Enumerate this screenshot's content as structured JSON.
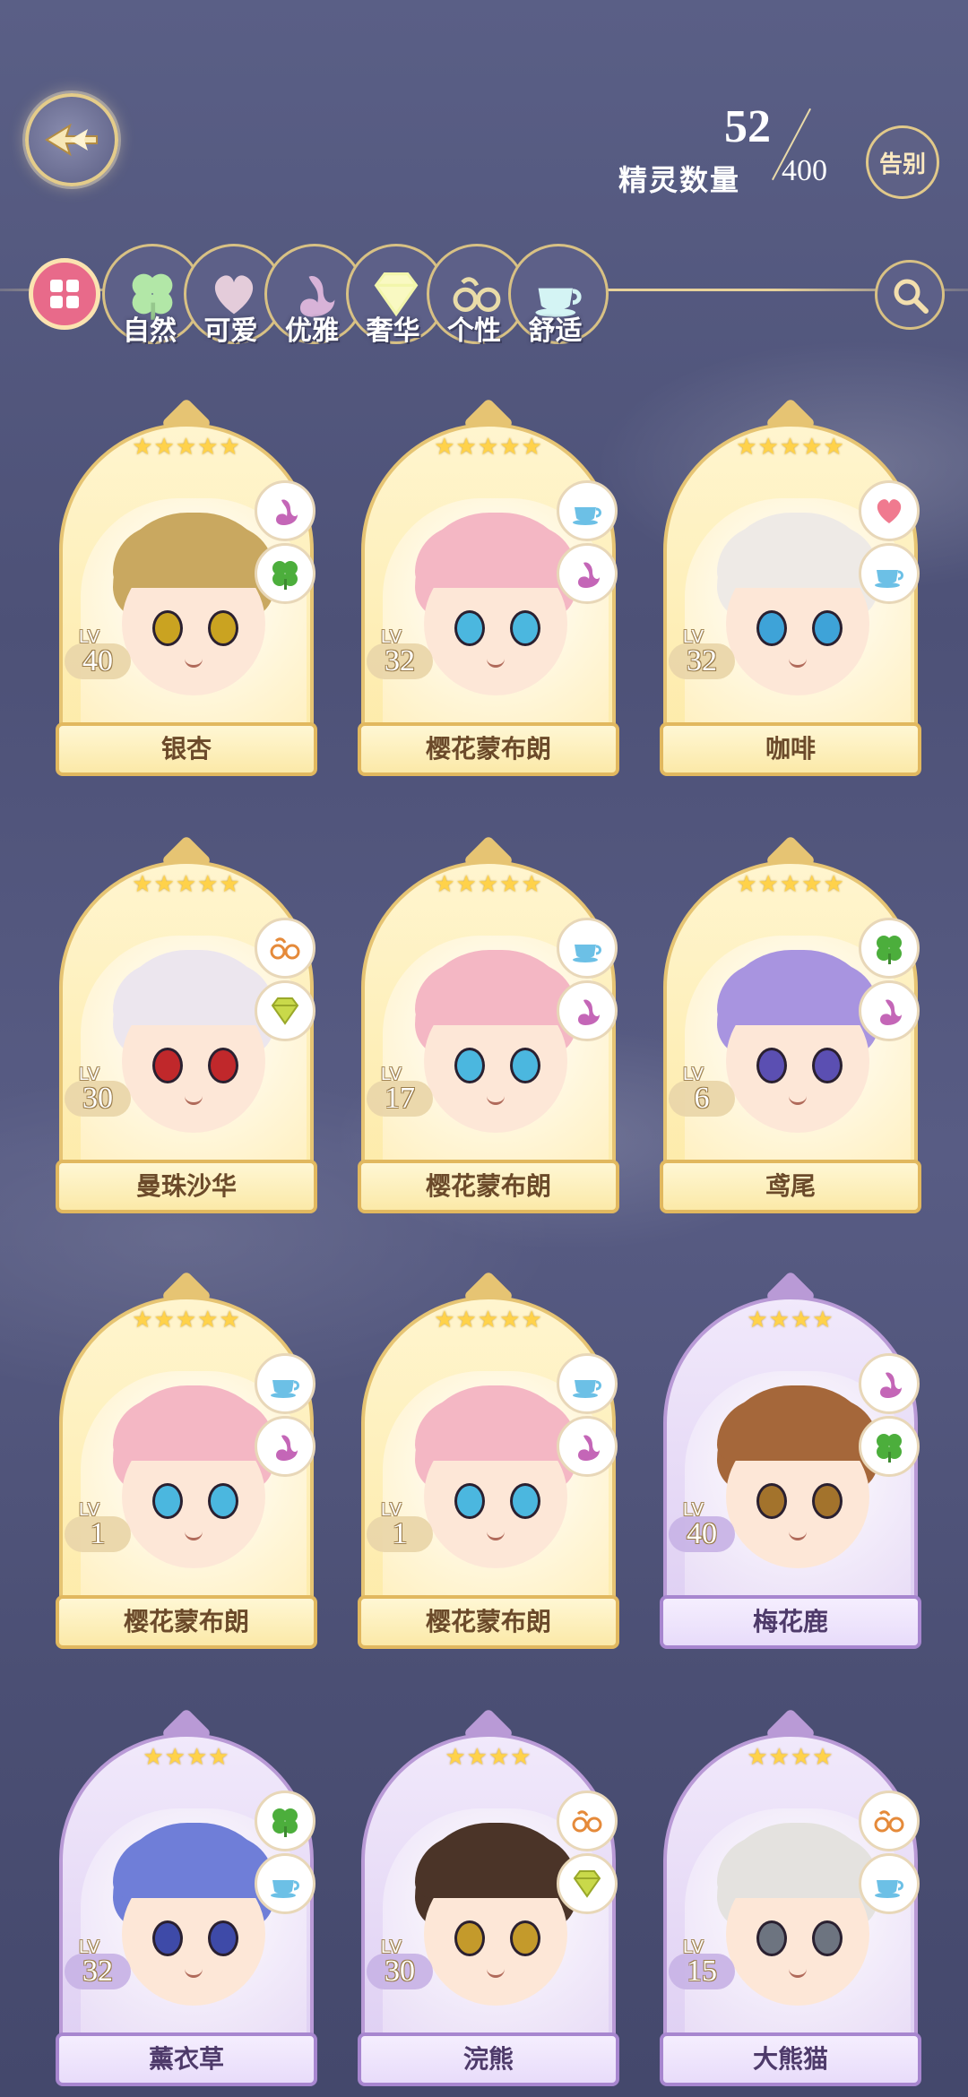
{
  "header": {
    "sprite_count_label": "精灵数量",
    "sprite_count_current": "52",
    "sprite_count_total": "400",
    "farewell_label": "告别"
  },
  "filters": [
    {
      "id": "all",
      "label": "",
      "icon": "grid-icon"
    },
    {
      "id": "nature",
      "label": "自然",
      "icon": "clover-icon"
    },
    {
      "id": "cute",
      "label": "可爱",
      "icon": "heart-icon"
    },
    {
      "id": "elegant",
      "label": "优雅",
      "icon": "swan-icon"
    },
    {
      "id": "luxury",
      "label": "奢华",
      "icon": "diamond-icon"
    },
    {
      "id": "personality",
      "label": "个性",
      "icon": "glasses-icon"
    },
    {
      "id": "comfort",
      "label": "舒适",
      "icon": "teacup-icon"
    },
    {
      "id": "search",
      "label": "",
      "icon": "search-icon"
    }
  ],
  "cards": [
    {
      "name": "银杏",
      "lv_prefix": "LV",
      "level": "40",
      "stars": "★★★★★",
      "rarity": "gold",
      "traits": [
        "swan-icon",
        "clover-icon"
      ],
      "hair": "#c9a860",
      "eyes": "#caa321",
      "bg": "#fff0c0"
    },
    {
      "name": "樱花蒙布朗",
      "lv_prefix": "LV",
      "level": "32",
      "stars": "★★★★★",
      "rarity": "gold",
      "traits": [
        "teacup-icon",
        "swan-icon"
      ],
      "hair": "#f4b7c4",
      "eyes": "#4bb7df",
      "bg": "#fff0c0"
    },
    {
      "name": "咖啡",
      "lv_prefix": "LV",
      "level": "32",
      "stars": "★★★★★",
      "rarity": "gold",
      "traits": [
        "heart-icon",
        "teacup-icon"
      ],
      "hair": "#eeeae6",
      "eyes": "#3ea3d8",
      "bg": "#fff0c0"
    },
    {
      "name": "曼珠沙华",
      "lv_prefix": "LV",
      "level": "30",
      "stars": "★★★★★",
      "rarity": "gold",
      "traits": [
        "glasses-icon",
        "diamond-icon"
      ],
      "hair": "#ece6ee",
      "eyes": "#c0282b",
      "bg": "#fff0c0"
    },
    {
      "name": "樱花蒙布朗",
      "lv_prefix": "LV",
      "level": "17",
      "stars": "★★★★★",
      "rarity": "gold",
      "traits": [
        "teacup-icon",
        "swan-icon"
      ],
      "hair": "#f4b7c4",
      "eyes": "#4bb7df",
      "bg": "#fff0c0"
    },
    {
      "name": "鸢尾",
      "lv_prefix": "LV",
      "level": "6",
      "stars": "★★★★★",
      "rarity": "gold",
      "traits": [
        "clover-icon",
        "swan-icon"
      ],
      "hair": "#a894e0",
      "eyes": "#5b4fb2",
      "bg": "#fff0c0"
    },
    {
      "name": "樱花蒙布朗",
      "lv_prefix": "LV",
      "level": "1",
      "stars": "★★★★★",
      "rarity": "gold",
      "traits": [
        "teacup-icon",
        "swan-icon"
      ],
      "hair": "#f4b7c4",
      "eyes": "#4bb7df",
      "bg": "#fff0c0"
    },
    {
      "name": "樱花蒙布朗",
      "lv_prefix": "LV",
      "level": "1",
      "stars": "★★★★★",
      "rarity": "gold",
      "traits": [
        "teacup-icon",
        "swan-icon"
      ],
      "hair": "#f4b7c4",
      "eyes": "#4bb7df",
      "bg": "#fff0c0"
    },
    {
      "name": "梅花鹿",
      "lv_prefix": "LV",
      "level": "40",
      "stars": "★★★★",
      "rarity": "purple",
      "traits": [
        "swan-icon",
        "clover-icon"
      ],
      "hair": "#a5673a",
      "eyes": "#a3732c",
      "bg": "#e8dcf6"
    },
    {
      "name": "薰衣草",
      "lv_prefix": "LV",
      "level": "32",
      "stars": "★★★★",
      "rarity": "purple",
      "traits": [
        "clover-icon",
        "teacup-icon"
      ],
      "hair": "#6f7ed8",
      "eyes": "#3e4aa8",
      "bg": "#e8dcf6"
    },
    {
      "name": "浣熊",
      "lv_prefix": "LV",
      "level": "30",
      "stars": "★★★★",
      "rarity": "purple",
      "traits": [
        "glasses-icon",
        "diamond-icon"
      ],
      "hair": "#4b3428",
      "eyes": "#c49a2b",
      "bg": "#e8dcf6"
    },
    {
      "name": "大熊猫",
      "lv_prefix": "LV",
      "level": "15",
      "stars": "★★★★",
      "rarity": "purple",
      "traits": [
        "glasses-icon",
        "teacup-icon"
      ],
      "hair": "#e4e2df",
      "eyes": "#6d7480",
      "bg": "#e8dcf6"
    }
  ],
  "colors": {
    "gold_border": "#e6c473",
    "purple_border": "#b99ad6",
    "accent_pink": "#e86a8a"
  }
}
